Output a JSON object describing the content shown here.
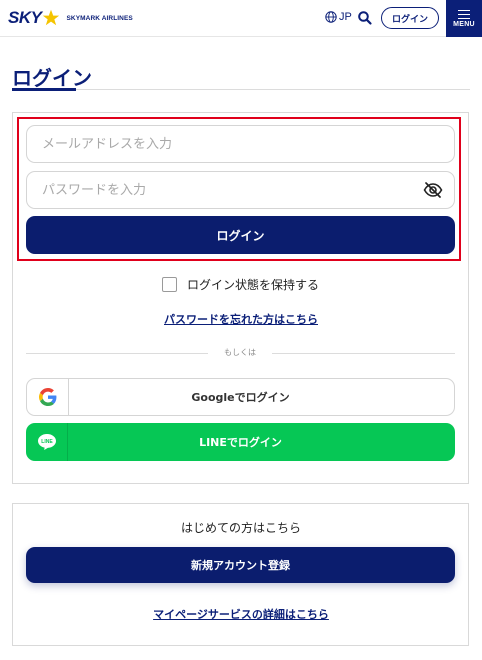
{
  "header": {
    "logo_text": "SKY",
    "logo_sub": "SKYMARK AIRLINES",
    "language": "JP",
    "login_label": "ログイン",
    "menu_label": "MENU"
  },
  "page": {
    "title": "ログイン"
  },
  "login_form": {
    "email_placeholder": "メールアドレスを入力",
    "email_value": "",
    "password_placeholder": "パスワードを入力",
    "password_value": "",
    "submit_label": "ログイン",
    "remember_label": "ログイン状態を保持する",
    "remember_checked": false,
    "forgot_link": "パスワードを忘れた方はこちら",
    "divider_text": "もしくは"
  },
  "social_login": {
    "google_label": "Googleでログイン",
    "line_label": "LINEでログイン",
    "line_icon_text": "LINE"
  },
  "new_user": {
    "heading": "はじめての方はこちら",
    "register_label": "新規アカウント登録",
    "mypage_link": "マイページサービスの詳細はこちら"
  },
  "colors": {
    "brand_navy": "#0b1d6e",
    "line_green": "#06c755",
    "highlight_red": "#e0001b",
    "star_yellow": "#f5c400"
  }
}
